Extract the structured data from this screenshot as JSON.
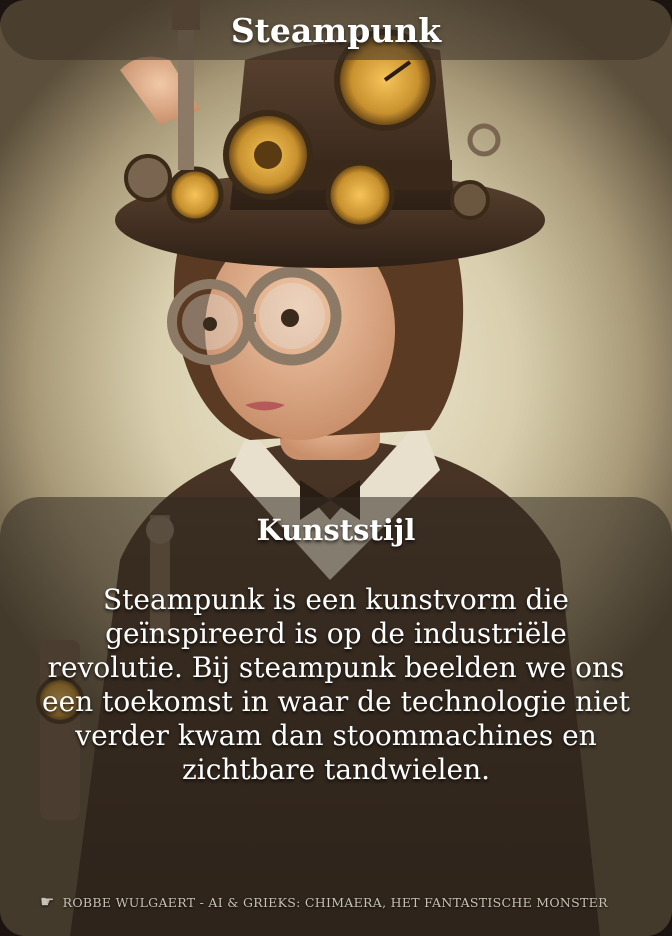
{
  "card": {
    "title": "Steampunk",
    "section_heading": "Kunststijl",
    "description": "Steampunk is een kunstvorm die geïnspireerd is op de industriële revolutie. Bij steampunk beelden we ons een toekomst in waar de technologie niet verder kwam dan stoommachines en zichtbare tandwielen.",
    "credit": "ROBBE WULGAERT - AI & GRIEKS: CHIMAERA, HET FANTASTISCHE MONSTER"
  },
  "icons": {
    "credit_icon": "pointing-hand-icon",
    "illustration": "steampunk-woman-portrait"
  },
  "colors": {
    "panel_overlay": "#3c3226",
    "text": "#ffffff",
    "credit_text": "#c9c2b4",
    "brass": "#c8912e"
  }
}
